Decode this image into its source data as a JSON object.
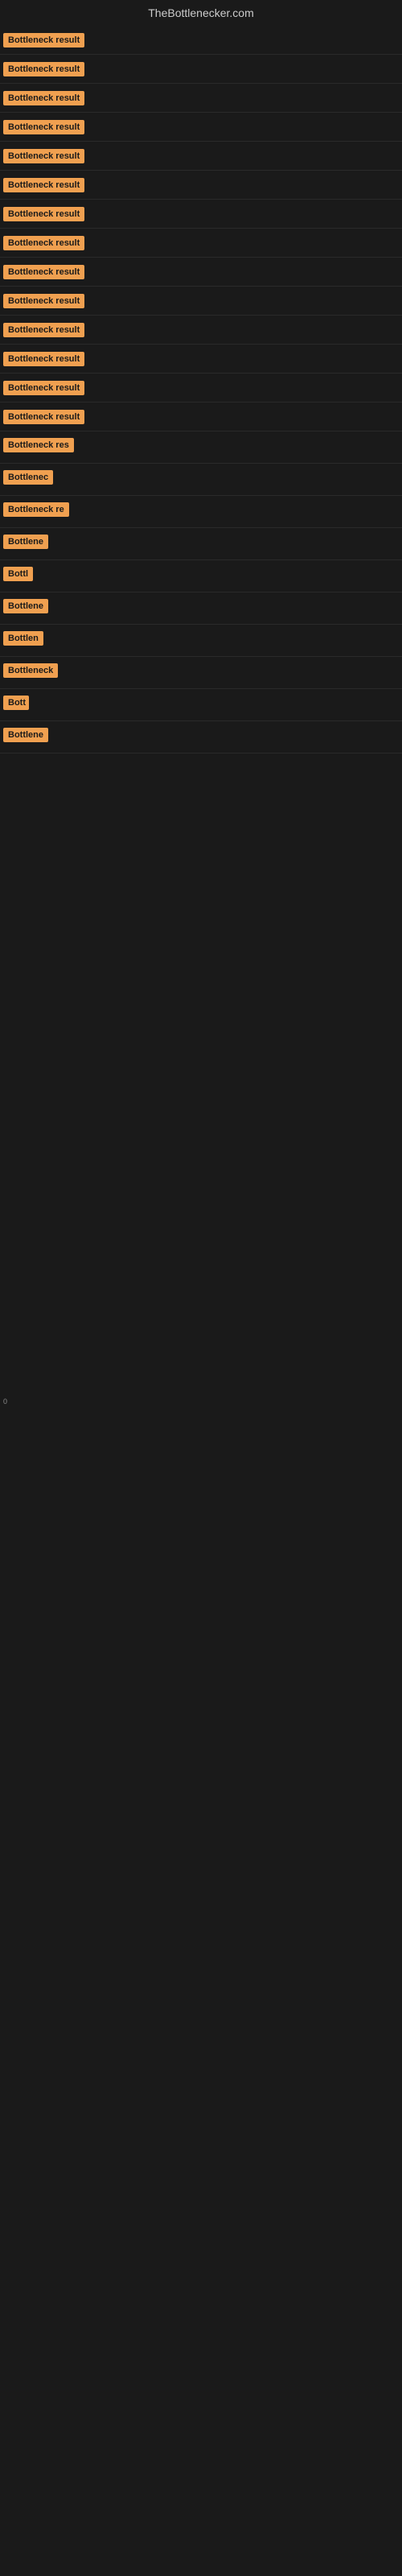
{
  "header": {
    "site_title": "TheBottlenecker.com"
  },
  "items": [
    {
      "id": 1,
      "label": "Bottleneck result",
      "visible_width": "full"
    },
    {
      "id": 2,
      "label": "Bottleneck result",
      "visible_width": "full"
    },
    {
      "id": 3,
      "label": "Bottleneck result",
      "visible_width": "full"
    },
    {
      "id": 4,
      "label": "Bottleneck result",
      "visible_width": "full"
    },
    {
      "id": 5,
      "label": "Bottleneck result",
      "visible_width": "full"
    },
    {
      "id": 6,
      "label": "Bottleneck result",
      "visible_width": "full"
    },
    {
      "id": 7,
      "label": "Bottleneck result",
      "visible_width": "full"
    },
    {
      "id": 8,
      "label": "Bottleneck result",
      "visible_width": "full"
    },
    {
      "id": 9,
      "label": "Bottleneck result",
      "visible_width": "full"
    },
    {
      "id": 10,
      "label": "Bottleneck result",
      "visible_width": "full"
    },
    {
      "id": 11,
      "label": "Bottleneck result",
      "visible_width": "full"
    },
    {
      "id": 12,
      "label": "Bottleneck result",
      "visible_width": "full"
    },
    {
      "id": 13,
      "label": "Bottleneck result",
      "visible_width": "full"
    },
    {
      "id": 14,
      "label": "Bottleneck result",
      "visible_width": "full"
    },
    {
      "id": 15,
      "label": "Bottleneck res",
      "visible_width": "partial"
    },
    {
      "id": 16,
      "label": "Bottlenec",
      "visible_width": "small"
    },
    {
      "id": 17,
      "label": "Bottleneck re",
      "visible_width": "partial2"
    },
    {
      "id": 18,
      "label": "Bottlene",
      "visible_width": "small2"
    },
    {
      "id": 19,
      "label": "Bottl",
      "visible_width": "tiny"
    },
    {
      "id": 20,
      "label": "Bottlene",
      "visible_width": "small2"
    },
    {
      "id": 21,
      "label": "Bottlen",
      "visible_width": "small3"
    },
    {
      "id": 22,
      "label": "Bottleneck",
      "visible_width": "medium"
    },
    {
      "id": 23,
      "label": "Bott",
      "visible_width": "tiny2"
    },
    {
      "id": 24,
      "label": "Bottlene",
      "visible_width": "small2"
    }
  ],
  "footer_label": "0",
  "badge_color": "#f0a050",
  "bg_color": "#1a1a1a"
}
